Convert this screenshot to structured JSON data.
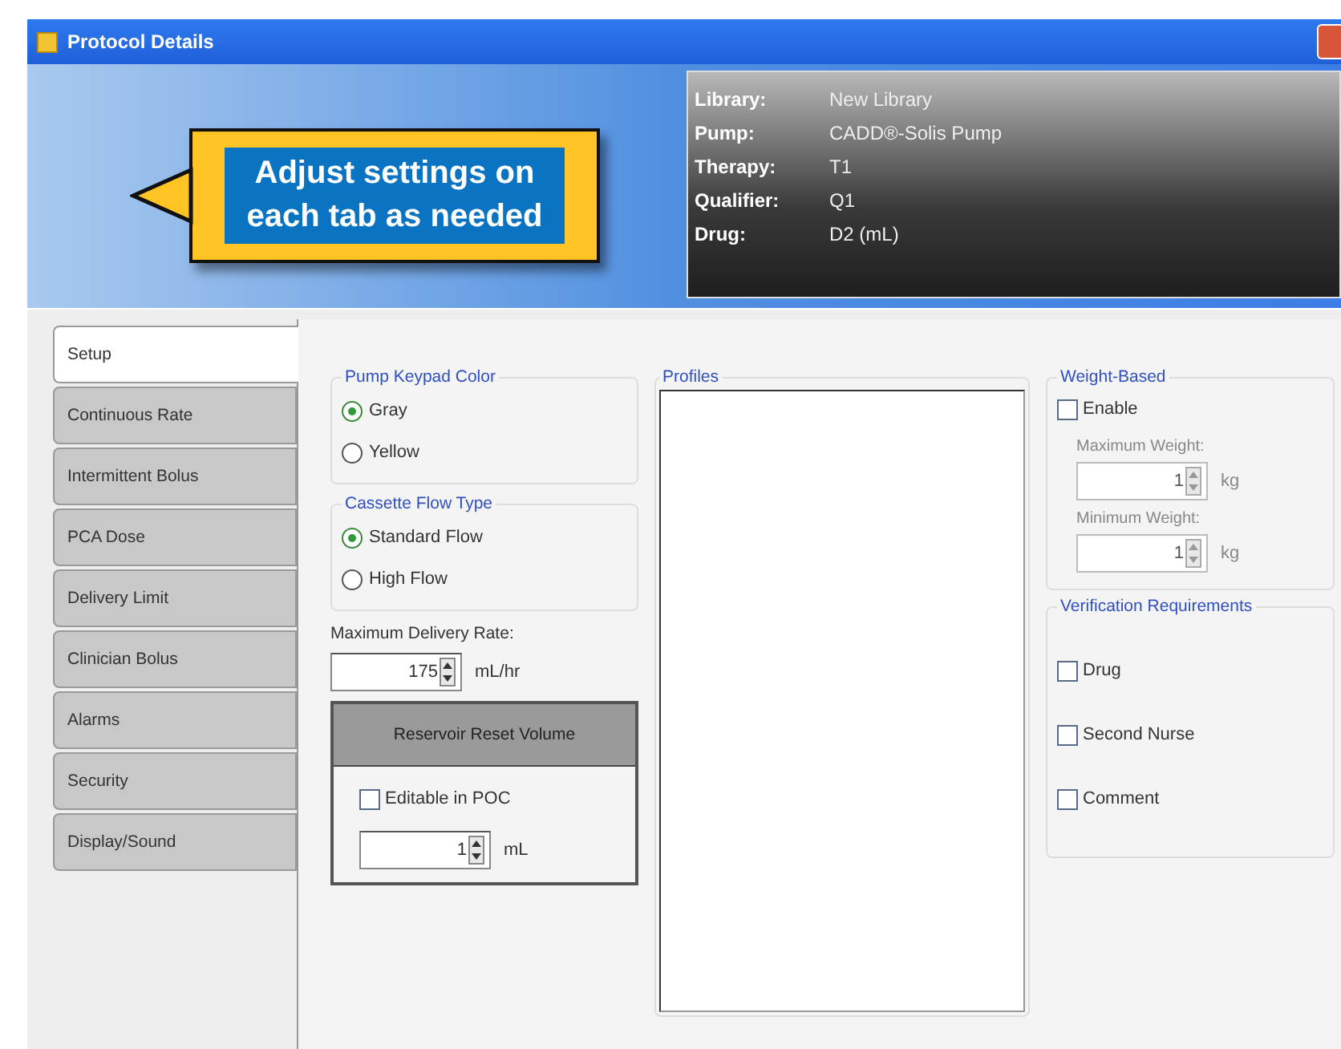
{
  "window": {
    "title": "Protocol Details"
  },
  "callout": {
    "text": "Adjust settings on each tab as needed"
  },
  "info": [
    {
      "label": "Library:",
      "value": "New Library"
    },
    {
      "label": "Pump:",
      "value": "CADD®-Solis Pump"
    },
    {
      "label": "Therapy:",
      "value": "T1"
    },
    {
      "label": "Qualifier:",
      "value": "Q1"
    },
    {
      "label": "Drug:",
      "value": "D2 (mL)"
    }
  ],
  "tabs": [
    {
      "label": "Setup",
      "selected": true
    },
    {
      "label": "Continuous Rate",
      "selected": false
    },
    {
      "label": "Intermittent Bolus",
      "selected": false
    },
    {
      "label": "PCA Dose",
      "selected": false
    },
    {
      "label": "Delivery Limit",
      "selected": false
    },
    {
      "label": "Clinician Bolus",
      "selected": false
    },
    {
      "label": "Alarms",
      "selected": false
    },
    {
      "label": "Security",
      "selected": false
    },
    {
      "label": "Display/Sound",
      "selected": false
    }
  ],
  "pump_keypad_color": {
    "legend": "Pump Keypad Color",
    "options": [
      {
        "label": "Gray",
        "selected": true
      },
      {
        "label": "Yellow",
        "selected": false
      }
    ]
  },
  "cassette_flow_type": {
    "legend": "Cassette Flow Type",
    "options": [
      {
        "label": "Standard Flow",
        "selected": true
      },
      {
        "label": "High Flow",
        "selected": false
      }
    ]
  },
  "max_delivery_rate": {
    "label": "Maximum Delivery Rate:",
    "value": "175",
    "unit": "mL/hr"
  },
  "reservoir_reset_volume": {
    "title": "Reservoir Reset Volume",
    "editable": {
      "label": "Editable in POC",
      "checked": false
    },
    "value": "1",
    "unit": "mL"
  },
  "profiles": {
    "legend": "Profiles"
  },
  "weight_based": {
    "legend": "Weight-Based",
    "enable": {
      "label": "Enable",
      "checked": false
    },
    "fields": [
      {
        "label": "Maximum Weight:",
        "value": "1",
        "unit": "kg",
        "disabled": true
      },
      {
        "label": "Minimum Weight:",
        "value": "1",
        "unit": "kg",
        "disabled": true
      }
    ]
  },
  "verification": {
    "legend": "Verification Requirements",
    "items": [
      {
        "label": "Drug",
        "checked": false
      },
      {
        "label": "Second Nurse",
        "checked": false
      },
      {
        "label": "Comment",
        "checked": false
      }
    ]
  }
}
